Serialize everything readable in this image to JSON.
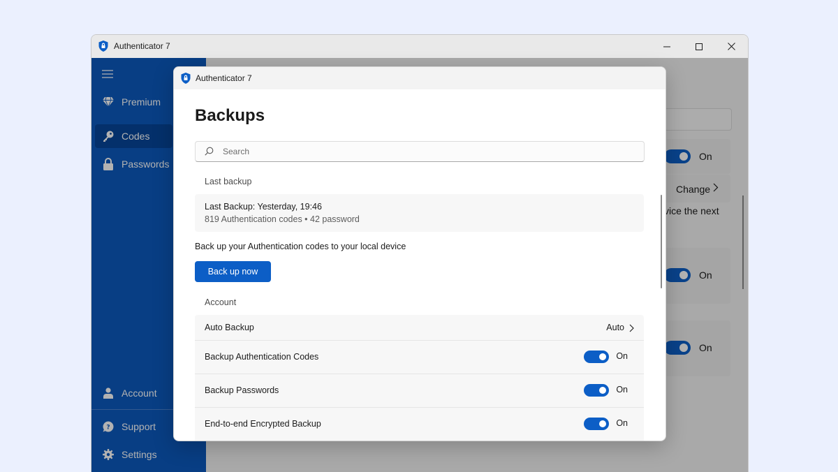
{
  "window": {
    "title": "Authenticator 7"
  },
  "sidebar": {
    "items": [
      {
        "label": "Premium",
        "icon": "diamond-icon"
      },
      {
        "label": "Codes",
        "icon": "key-icon",
        "selected": true
      },
      {
        "label": "Passwords",
        "icon": "lock-icon"
      }
    ],
    "bottom_items": [
      {
        "label": "Account",
        "icon": "person-icon"
      },
      {
        "label": "Support",
        "icon": "help-chat-icon"
      },
      {
        "label": "Settings",
        "icon": "gear-icon"
      }
    ]
  },
  "background_page": {
    "toggle_1_state": "On",
    "change_label": "Change",
    "partial_text": "vice the next",
    "toggle_2_state": "On",
    "toggle_3_state": "On"
  },
  "dialog": {
    "title": "Authenticator 7",
    "heading": "Backups",
    "search_placeholder": "Search",
    "last_backup_section": "Last backup",
    "last_backup_line": "Last Backup: Yesterday, 19:46",
    "last_backup_details": "819 Authentication codes • 42 password",
    "backup_description": "Back up your Authentication codes to your local device",
    "backup_button": "Back up now",
    "account_section": "Account",
    "auto_backup": {
      "label": "Auto Backup",
      "value": "Auto"
    },
    "settings": [
      {
        "label": "Backup Authentication Codes",
        "state": "On"
      },
      {
        "label": "Backup Passwords",
        "state": "On"
      },
      {
        "label": "End-to-end Encrypted Backup",
        "state": "On"
      }
    ]
  },
  "colors": {
    "accent": "#0c5ec6",
    "sidebar": "#0c59be",
    "page_background": "#ebf0fe"
  }
}
